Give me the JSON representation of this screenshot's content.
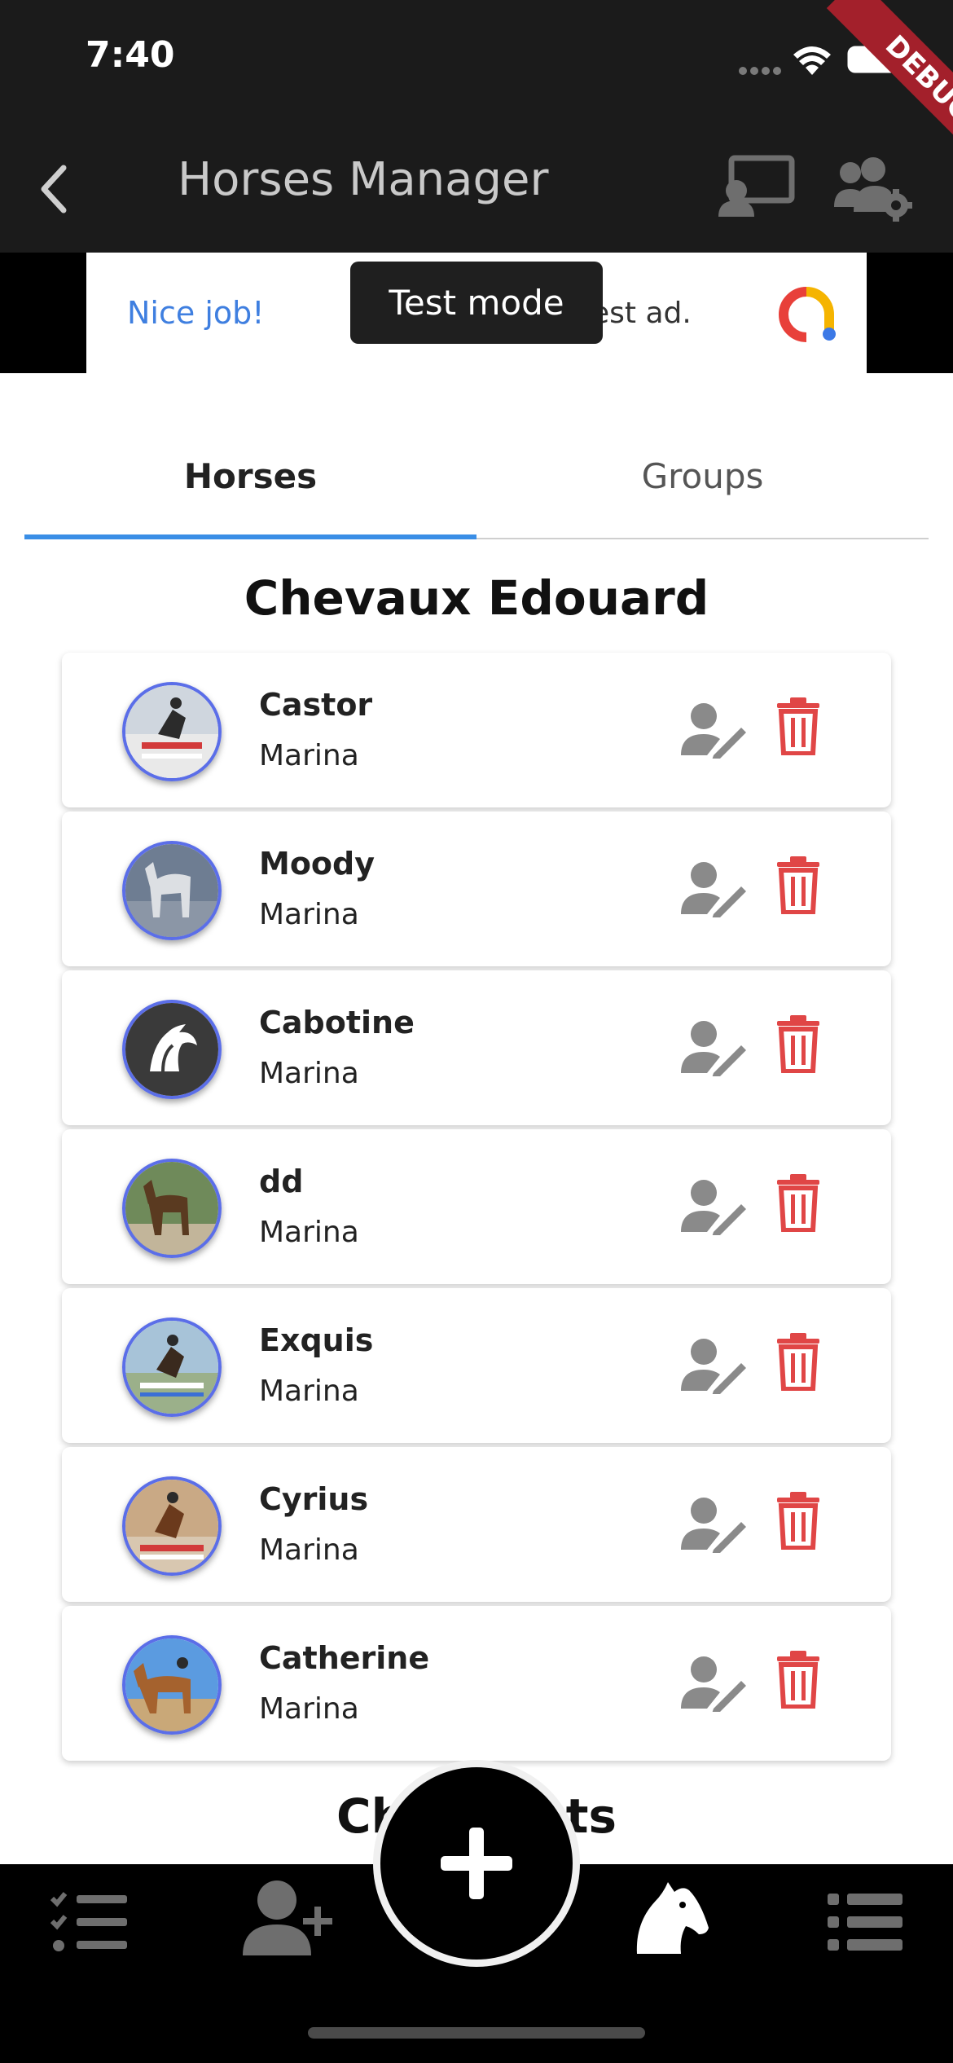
{
  "status_bar": {
    "time": "7:40"
  },
  "app_bar": {
    "title": "Horses Manager"
  },
  "debug_banner": {
    "label": "DEBUG"
  },
  "ad": {
    "nice_job": "Nice job!",
    "text": "est ad.",
    "toast": "Test mode"
  },
  "tabs": [
    {
      "label": "Horses",
      "active": true
    },
    {
      "label": "Groups",
      "active": false
    }
  ],
  "sections": [
    {
      "title": "Chevaux Edouard"
    },
    {
      "title": "Chev          ients"
    }
  ],
  "horses": [
    {
      "name": "Castor",
      "owner": "Marina",
      "avatar": "photo-jumping"
    },
    {
      "name": "Moody",
      "owner": "Marina",
      "avatar": "photo-grey-horse"
    },
    {
      "name": "Cabotine",
      "owner": "Marina",
      "avatar": "horse-logo"
    },
    {
      "name": "dd",
      "owner": "Marina",
      "avatar": "photo-bay-horse"
    },
    {
      "name": "Exquis",
      "owner": "Marina",
      "avatar": "photo-jumping"
    },
    {
      "name": "Cyrius",
      "owner": "Marina",
      "avatar": "photo-jumping"
    },
    {
      "name": "Catherine",
      "owner": "Marina",
      "avatar": "photo-rider"
    }
  ],
  "bottom_nav": [
    "checklist-icon",
    "add-person-icon",
    "add-icon",
    "horse-head-icon",
    "list-icon"
  ],
  "colors": {
    "bar": "#1b1b1b",
    "accent": "#3a8ee6",
    "delete": "#e04646",
    "edit": "#8a8a8a",
    "avatar_ring": "#5b6ee8"
  }
}
